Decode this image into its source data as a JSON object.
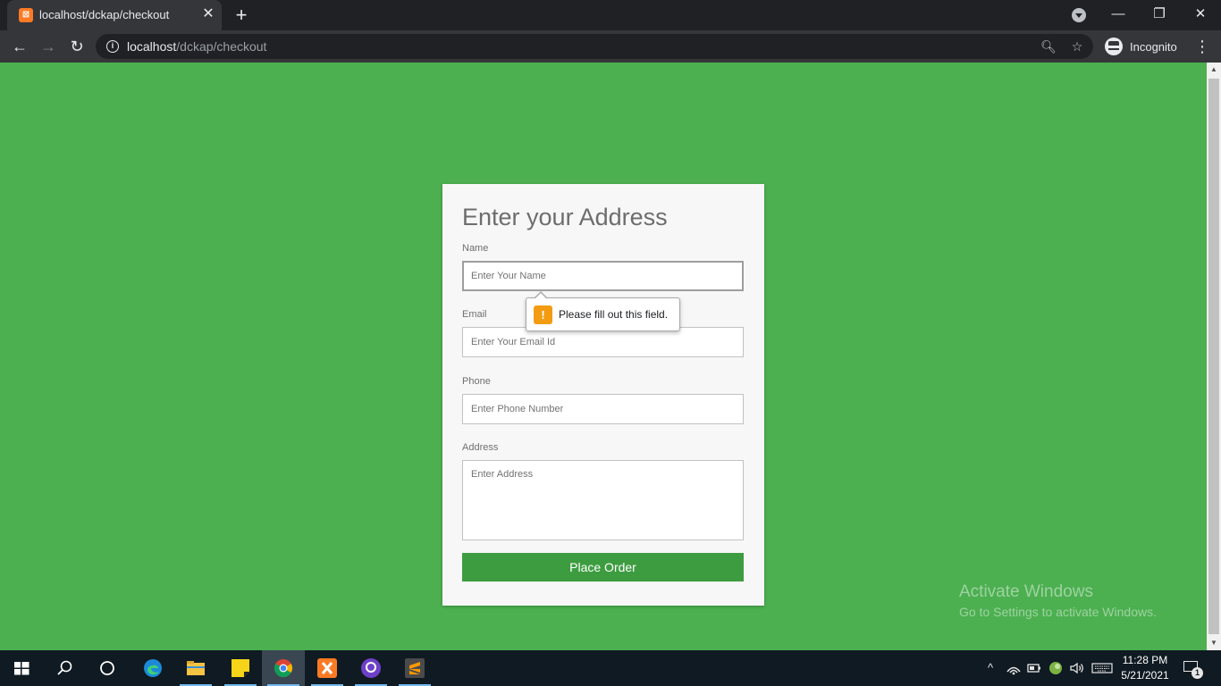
{
  "browser": {
    "tab": {
      "title": "localhost/dckap/checkout",
      "close_label": "✕"
    },
    "new_tab_label": "+",
    "window_controls": {
      "minimize": "—",
      "restore": "❐",
      "close": "✕"
    },
    "nav": {
      "back": "←",
      "forward": "→",
      "reload": "↻"
    },
    "address": {
      "host": "localhost",
      "path": "/dckap/checkout"
    },
    "incognito_label": "Incognito",
    "menu_label": "⋮"
  },
  "form": {
    "title": "Enter your Address",
    "fields": [
      {
        "label": "Name",
        "placeholder": "Enter Your Name"
      },
      {
        "label": "Email",
        "placeholder": "Enter Your Email Id"
      },
      {
        "label": "Phone",
        "placeholder": "Enter Phone Number"
      },
      {
        "label": "Address",
        "placeholder": "Enter Address"
      }
    ],
    "submit_label": "Place Order"
  },
  "validation": {
    "icon": "!",
    "message": "Please fill out this field."
  },
  "watermark": {
    "title": "Activate Windows",
    "subtitle": "Go to Settings to activate Windows."
  },
  "taskbar": {
    "apps": [
      "start-icon",
      "search-icon",
      "task-view-icon",
      "edge-icon",
      "file-explorer-icon",
      "sticky-notes-icon",
      "chrome-icon",
      "xampp-icon",
      "github-desktop-icon",
      "sublime-text-icon"
    ],
    "tray": {
      "chevron": "^",
      "time": "11:28 PM",
      "date": "5/21/2021",
      "notification_count": "1"
    }
  },
  "colors": {
    "page_bg": "#4caf50",
    "button": "#3d9c40",
    "card": "#f7f7f7",
    "warning": "#f39c12"
  }
}
